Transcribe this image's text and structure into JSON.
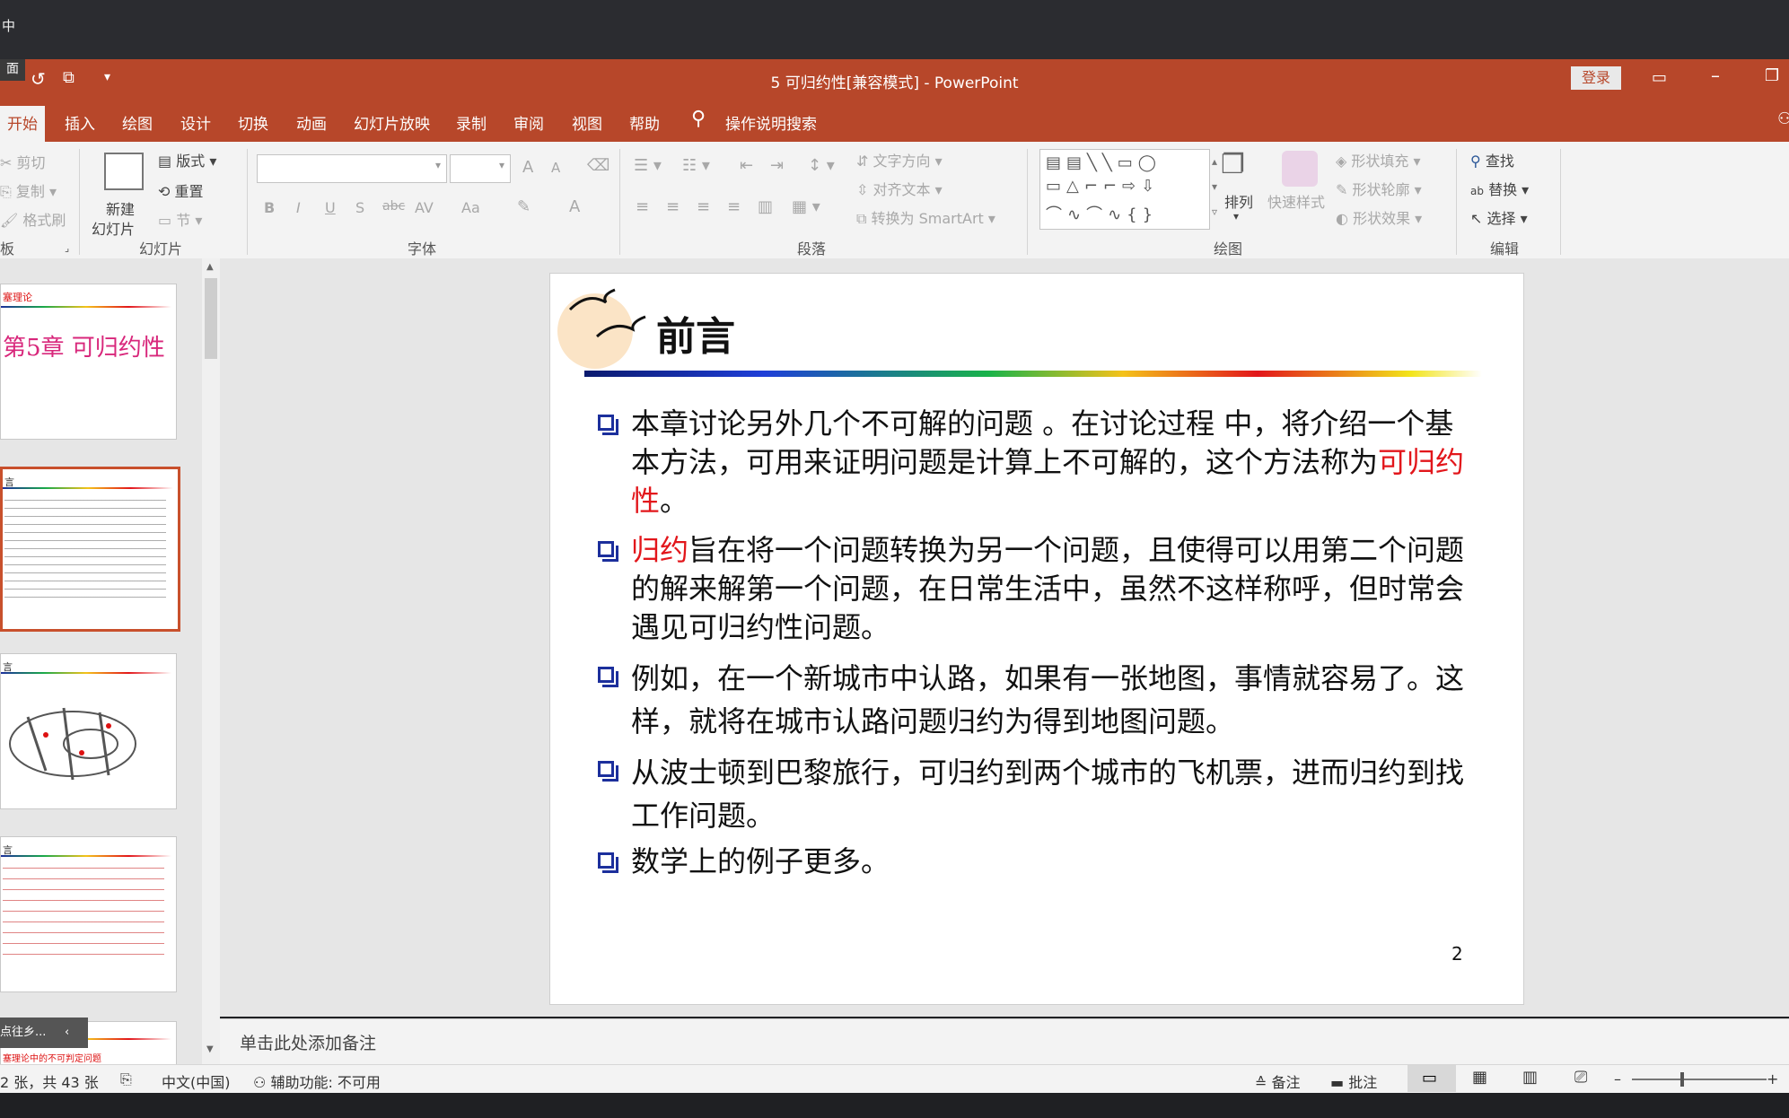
{
  "window": {
    "top_left_fragment": "中",
    "side_fragment": "面",
    "title": "5 可归约性[兼容模式] - PowerPoint",
    "login": "登录"
  },
  "tabs": [
    "开始",
    "插入",
    "绘图",
    "设计",
    "切换",
    "动画",
    "幻灯片放映",
    "录制",
    "审阅",
    "视图",
    "帮助"
  ],
  "tell_me": "操作说明搜索",
  "ribbon": {
    "clipboard": {
      "cut": "剪切",
      "copy": "复制",
      "format_painter": "格式刷",
      "label": "板"
    },
    "slides": {
      "new_slide_1": "新建",
      "new_slide_2": "幻灯片",
      "layout": "版式",
      "reset": "重置",
      "section": "节",
      "label": "幻灯片"
    },
    "font": {
      "label": "字体",
      "bold": "B",
      "italic": "I",
      "underline": "U",
      "shadow": "S",
      "strike": "abc",
      "spacing": "AV",
      "case": "Aa",
      "color": "A",
      "grow": "A",
      "shrink": "A"
    },
    "paragraph": {
      "text_direction": "文字方向",
      "align_text": "对齐文本",
      "smartart": "转换为 SmartArt",
      "label": "段落"
    },
    "drawing": {
      "arrange": "排列",
      "quick_styles": "快速样式",
      "shape_fill": "形状填充",
      "shape_outline": "形状轮廓",
      "shape_effects": "形状效果",
      "label": "绘图"
    },
    "editing": {
      "find": "查找",
      "replace": "替换",
      "select": "选择",
      "label": "编辑"
    }
  },
  "thumbnails": {
    "t1_header": "塞理论",
    "t1_title": "第5章 可归约性",
    "t2_header": "言",
    "t3_header": "言",
    "t4_header": "言",
    "t5_tooltip": "点往乡...",
    "t5_text": "塞理论中的不可判定问题"
  },
  "slide": {
    "title": "前言",
    "p1_a": "本章讨论另外几个不可解的问题 。在讨论过程 中，将介绍一个基本方法，可用来证明问题是计算上不可解的，这个方法称为",
    "p1_red": "可归约性",
    "p1_b": "。",
    "p2_red": "归约",
    "p2_b": "旨在将一个问题转换为另一个问题，且使得可以用第二个问题的解来解第一个问题，在日常生活中，虽然不这样称呼，但时常会遇见可归约性问题。",
    "p3": "例如，在一个新城市中认路，如果有一张地图，事情就容易了。这样，就将在城市认路问题归约为得到地图问题。",
    "p4": "从波士顿到巴黎旅行，可归约到两个城市的飞机票，进而归约到找工作问题。",
    "p5": "数学上的例子更多。",
    "page_number": "2"
  },
  "notes_placeholder": "单击此处添加备注",
  "status": {
    "slide_count": "2 张，共 43 张",
    "language": "中文(中国)",
    "accessibility": "辅助功能: 不可用",
    "notes": "备注",
    "comments": "批注"
  },
  "colors": {
    "accent": "#b7472a",
    "bullet": "#1c2f9c",
    "highlight": "#e2161b"
  }
}
